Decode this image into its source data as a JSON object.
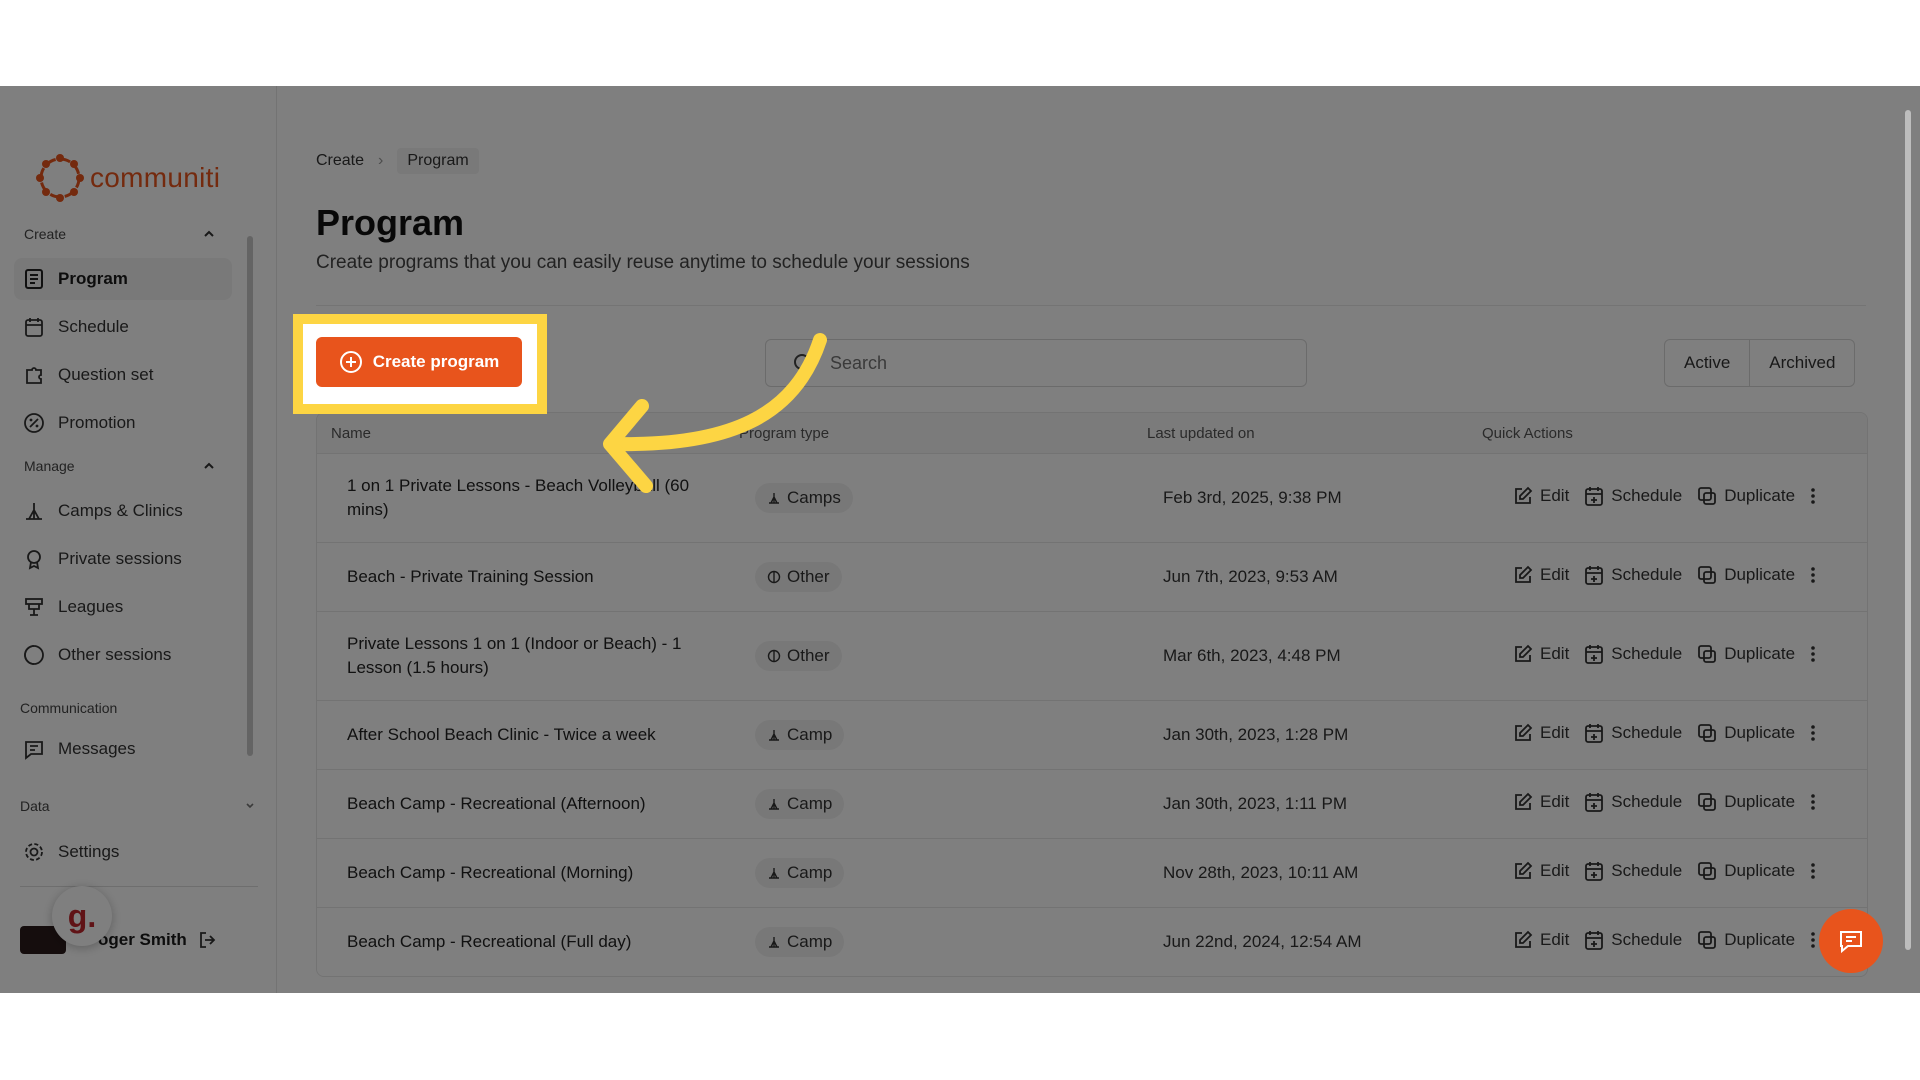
{
  "brand": {
    "name": "communiti",
    "accent": "#e8541c",
    "highlight": "#fdd543"
  },
  "sidebar": {
    "sections": [
      {
        "title": "Create",
        "items": [
          {
            "label": "Program",
            "icon": "program-icon",
            "active": true
          },
          {
            "label": "Schedule",
            "icon": "calendar-icon"
          },
          {
            "label": "Question set",
            "icon": "puzzle-icon"
          },
          {
            "label": "Promotion",
            "icon": "promotion-icon"
          }
        ]
      },
      {
        "title": "Manage",
        "items": [
          {
            "label": "Camps & Clinics",
            "icon": "camps-icon"
          },
          {
            "label": "Private sessions",
            "icon": "award-icon"
          },
          {
            "label": "Leagues",
            "icon": "leagues-icon"
          },
          {
            "label": "Other sessions",
            "icon": "other-icon"
          }
        ]
      },
      {
        "title": "Communication",
        "items": [
          {
            "label": "Messages",
            "icon": "message-icon"
          }
        ]
      },
      {
        "title": "Data",
        "items": [
          {
            "label": "Settings",
            "icon": "gear-icon"
          }
        ]
      }
    ],
    "user": {
      "name": "Roger Smith",
      "name_visible": "oger Smith",
      "badge": "g."
    }
  },
  "breadcrumb": {
    "root": "Create",
    "current": "Program"
  },
  "page": {
    "title": "Program",
    "subtitle": "Create programs that you can easily reuse anytime to schedule your sessions",
    "create_label": "Create program",
    "search_placeholder": "Search",
    "toggle": [
      "Active",
      "Archived"
    ]
  },
  "table": {
    "headers": [
      "Name",
      "Program type",
      "Last updated on",
      "Quick Actions"
    ],
    "actions": [
      "Edit",
      "Schedule",
      "Duplicate"
    ],
    "rows": [
      {
        "name": "1 on 1 Private Lessons - Beach Volleyball (60 mins)",
        "type": "Camps",
        "updated": "Feb 3rd, 2025, 9:38 PM"
      },
      {
        "name": "Beach - Private Training Session",
        "type": "Other",
        "updated": "Jun 7th, 2023, 9:53 AM"
      },
      {
        "name": "Private Lessons 1 on 1 (Indoor or Beach) - 1 Lesson (1.5 hours)",
        "type": "Other",
        "updated": "Mar 6th, 2023, 4:48 PM"
      },
      {
        "name": "After School Beach Clinic - Twice a week",
        "type": "Camp",
        "updated": "Jan 30th, 2023, 1:28 PM"
      },
      {
        "name": "Beach Camp - Recreational (Afternoon)",
        "type": "Camp",
        "updated": "Jan 30th, 2023, 1:11 PM"
      },
      {
        "name": "Beach Camp - Recreational (Morning)",
        "type": "Camp",
        "updated": "Nov 28th, 2023, 10:11 AM"
      },
      {
        "name": "Beach Camp - Recreational (Full day)",
        "type": "Camp",
        "updated": "Jun 22nd, 2024, 12:54 AM"
      }
    ]
  }
}
